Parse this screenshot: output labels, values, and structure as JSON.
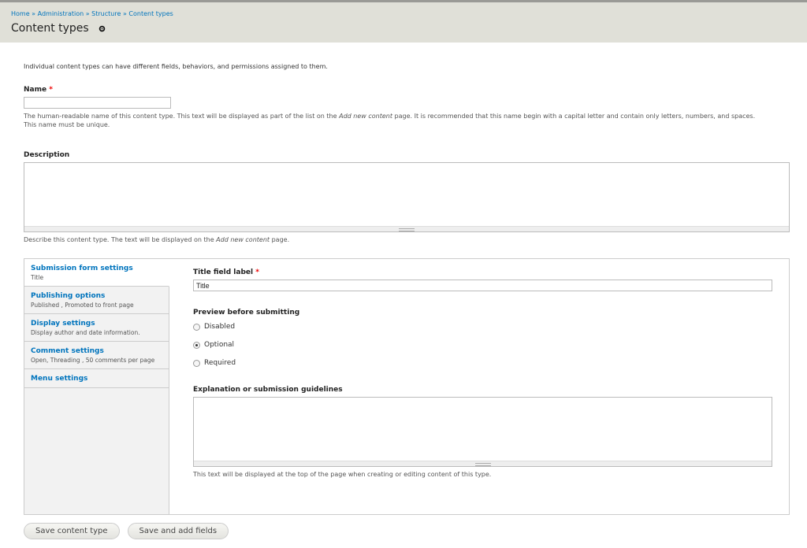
{
  "breadcrumb": {
    "items": [
      "Home",
      "Administration",
      "Structure",
      "Content types"
    ],
    "separator": "»"
  },
  "header": {
    "title": "Content types"
  },
  "intro": "Individual content types can have different fields, behaviors, and permissions assigned to them.",
  "name_field": {
    "label": "Name",
    "required_marker": "*",
    "value": "",
    "help_before": "The human-readable name of this content type. This text will be displayed as part of the list on the ",
    "help_link": "Add new content",
    "help_after": " page. It is recommended that this name begin with a capital letter and contain only letters, numbers, and spaces. This name must be unique."
  },
  "description_field": {
    "label": "Description",
    "value": "",
    "help_before": "Describe this content type. The text will be displayed on the ",
    "help_em": "Add new content",
    "help_after": " page."
  },
  "vertical_tabs": [
    {
      "title": "Submission form settings",
      "summary": "Title"
    },
    {
      "title": "Publishing options",
      "summary": "Published , Promoted to front page"
    },
    {
      "title": "Display settings",
      "summary": "Display author and date information."
    },
    {
      "title": "Comment settings",
      "summary": "Open, Threading , 50 comments per page"
    },
    {
      "title": "Menu settings",
      "summary": ""
    }
  ],
  "submission_pane": {
    "title_label": "Title field label",
    "required_marker": "*",
    "title_value": "Title",
    "preview_label": "Preview before submitting",
    "preview_options": [
      "Disabled",
      "Optional",
      "Required"
    ],
    "preview_selected": "Optional",
    "guidelines_label": "Explanation or submission guidelines",
    "guidelines_value": "",
    "guidelines_help": "This text will be displayed at the top of the page when creating or editing content of this type."
  },
  "actions": {
    "save_label": "Save content type",
    "save_add_label": "Save and add fields"
  },
  "icons": {
    "gear": "gear-icon"
  },
  "colors": {
    "link": "#0074bd",
    "required": "#ee0000",
    "header_bg": "#e0e0d8"
  }
}
